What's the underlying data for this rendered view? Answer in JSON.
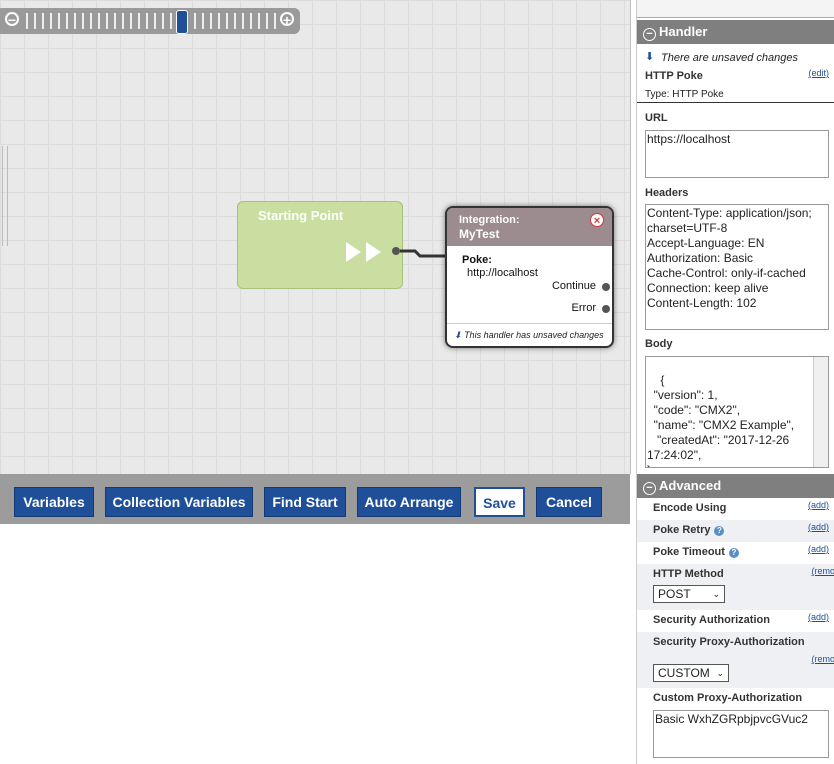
{
  "zoom": {
    "minus_icon": "zoom-out-icon",
    "plus_icon": "zoom-in-icon",
    "handle_mark": "|||"
  },
  "start_node": {
    "title": "Starting Point",
    "icon": "play-arrows-icon"
  },
  "integration_node": {
    "subtitle": "Integration:",
    "name": "MyTest",
    "poke_label": "Poke:",
    "poke_url": "http://localhost",
    "continue_label": "Continue",
    "error_label": "Error",
    "footer": "This handler has unsaved changes",
    "close_icon": "close-icon",
    "close_glyph": "×"
  },
  "toolbar": {
    "variables": "Variables",
    "collection_variables": "Collection Variables",
    "find_start": "Find Start",
    "auto_arrange": "Auto Arrange",
    "save": "Save",
    "cancel": "Cancel"
  },
  "panel": {
    "handler_header": "Handler",
    "unsaved_notice": "There are unsaved changes",
    "handler_name": "HTTP Poke",
    "edit_link": "(edit)",
    "type_line": "Type: HTTP Poke",
    "url_label": "URL",
    "url_value": "https://localhost",
    "headers_label": "Headers",
    "headers_value": "Content-Type: application/json; charset=UTF-8\nAccept-Language: EN\nAuthorization: Basic\nCache-Control: only-if-cached\nConnection: keep alive\nContent-Length: 102",
    "body_label": "Body",
    "body_value": "{\n  \"version\": 1,\n  \"code\": \"CMX2\",\n  \"name\": \"CMX2 Example\",\n   \"createdAt\": \"2017-12-26 17:24:02\",\n}",
    "advanced_header": "Advanced",
    "encode_label": "Encode Using",
    "encode_link": "(add)",
    "poke_retry_label": "Poke Retry",
    "poke_retry_link": "(add)",
    "poke_timeout_label": "Poke Timeout",
    "poke_timeout_link": "(add)",
    "http_method_label": "HTTP Method",
    "http_method_link": "(remo",
    "http_method_value": "POST",
    "sec_auth_label": "Security Authorization",
    "sec_auth_link": "(add)",
    "sec_proxy_label": "Security Proxy-Authorization",
    "sec_proxy_link": "(remo",
    "sec_proxy_value": "CUSTOM",
    "custom_proxy_label": "Custom Proxy-Authorization",
    "custom_proxy_value": "Basic WxhZGRpbjpvcGVuc2"
  }
}
